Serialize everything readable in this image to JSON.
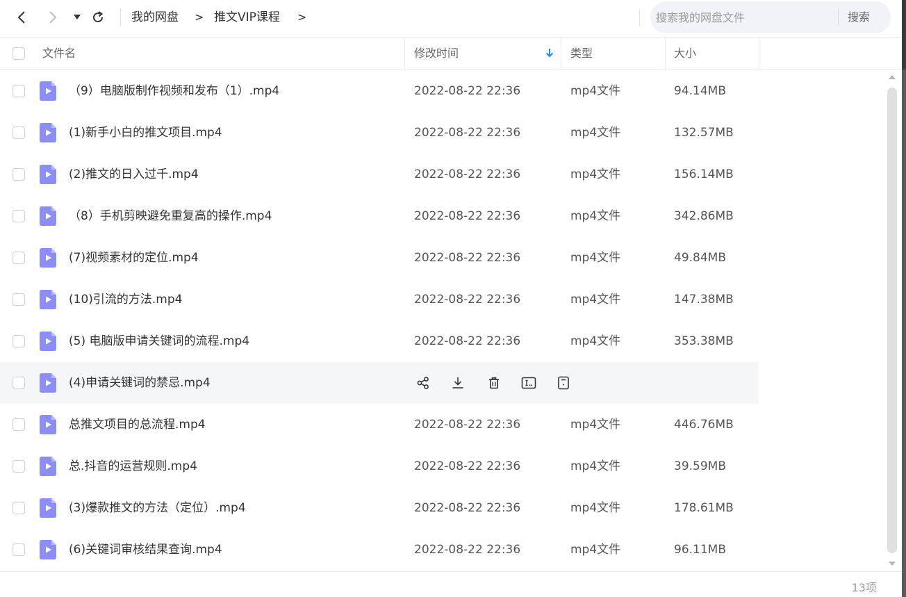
{
  "nav": {
    "breadcrumb": [
      "我的网盘",
      "推文VIP课程"
    ],
    "search_placeholder": "搜索我的网盘文件",
    "search_button": "搜索"
  },
  "columns": {
    "name": "文件名",
    "modified": "修改时间",
    "type": "类型",
    "size": "大小"
  },
  "accent_color": "#1a8cff",
  "file_icon_color": "#8d8ef5",
  "files": [
    {
      "name": "（9）电脑版制作视频和发布（1）.mp4",
      "modified": "2022-08-22 22:36",
      "type": "mp4文件",
      "size": "94.14MB"
    },
    {
      "name": "(1)新手小白的推文项目.mp4",
      "modified": "2022-08-22 22:36",
      "type": "mp4文件",
      "size": "132.57MB"
    },
    {
      "name": "(2)推文的日入过千.mp4",
      "modified": "2022-08-22 22:36",
      "type": "mp4文件",
      "size": "156.14MB"
    },
    {
      "name": "（8）手机剪映避免重复高的操作.mp4",
      "modified": "2022-08-22 22:36",
      "type": "mp4文件",
      "size": "342.86MB"
    },
    {
      "name": "(7)视频素材的定位.mp4",
      "modified": "2022-08-22 22:36",
      "type": "mp4文件",
      "size": "49.84MB"
    },
    {
      "name": "(10)引流的方法.mp4",
      "modified": "2022-08-22 22:36",
      "type": "mp4文件",
      "size": "147.38MB"
    },
    {
      "name": "(5) 电脑版申请关键词的流程.mp4",
      "modified": "2022-08-22 22:36",
      "type": "mp4文件",
      "size": "353.38MB"
    },
    {
      "name": "(4)申请关键词的禁忌.mp4",
      "modified": "",
      "type": "",
      "size": "",
      "hover": true
    },
    {
      "name": "总推文项目的总流程.mp4",
      "modified": "2022-08-22 22:36",
      "type": "mp4文件",
      "size": "446.76MB"
    },
    {
      "name": "总.抖音的运营规则.mp4",
      "modified": "2022-08-22 22:36",
      "type": "mp4文件",
      "size": "39.59MB"
    },
    {
      "name": "(3)爆款推文的方法（定位）.mp4",
      "modified": "2022-08-22 22:36",
      "type": "mp4文件",
      "size": "178.61MB"
    },
    {
      "name": "(6)关键词审核结果查询.mp4",
      "modified": "2022-08-22 22:36",
      "type": "mp4文件",
      "size": "96.11MB"
    }
  ],
  "row_actions": [
    "share-icon",
    "download-icon",
    "delete-icon",
    "rename-icon",
    "details-icon"
  ],
  "footer": {
    "count": "13项"
  }
}
